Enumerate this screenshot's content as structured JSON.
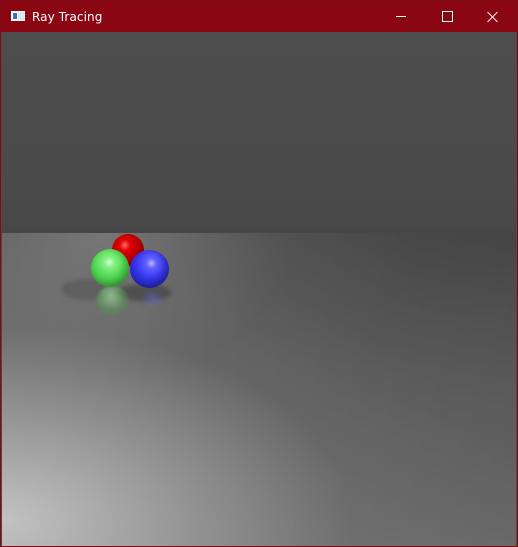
{
  "window": {
    "title": "Ray Tracing",
    "app_icon": "app-window-icon",
    "accent_color": "#8a0612",
    "controls": {
      "minimize_icon": "minimize-icon",
      "maximize_icon": "maximize-icon",
      "close_icon": "close-icon"
    }
  },
  "scene": {
    "background_color": "#4b4b4b",
    "spheres": [
      {
        "name": "red-sphere",
        "color": "#d00000"
      },
      {
        "name": "green-sphere",
        "color": "#57d657"
      },
      {
        "name": "blue-sphere",
        "color": "#3a3af0"
      }
    ]
  }
}
